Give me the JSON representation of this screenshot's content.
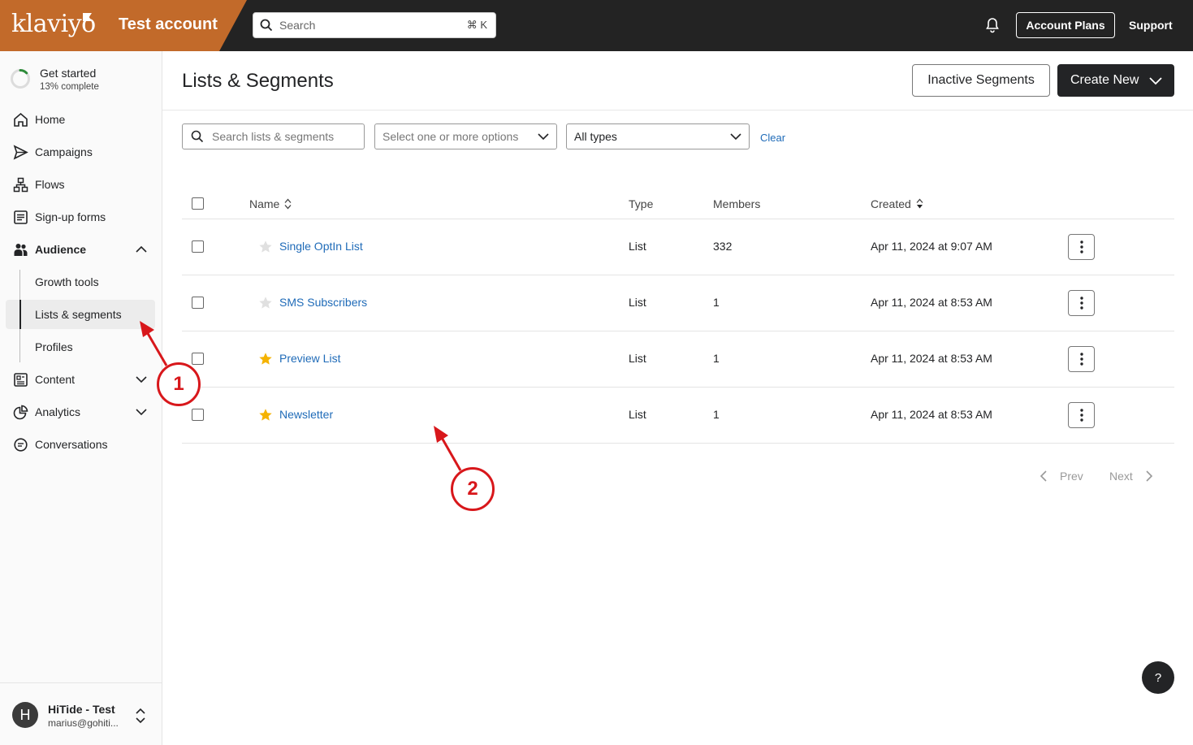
{
  "topbar": {
    "logo": "klaviyo",
    "account_name": "Test account",
    "search_placeholder": "Search",
    "search_shortcut": "⌘ K",
    "account_plans": "Account Plans",
    "support": "Support"
  },
  "sidebar": {
    "get_started": {
      "title": "Get started",
      "progress_text": "13% complete",
      "progress": 0.13
    },
    "items": [
      {
        "label": "Home"
      },
      {
        "label": "Campaigns"
      },
      {
        "label": "Flows"
      },
      {
        "label": "Sign-up forms"
      },
      {
        "label": "Audience"
      },
      {
        "label": "Growth tools"
      },
      {
        "label": "Lists & segments"
      },
      {
        "label": "Profiles"
      },
      {
        "label": "Content"
      },
      {
        "label": "Analytics"
      },
      {
        "label": "Conversations"
      }
    ],
    "user": {
      "initial": "H",
      "name": "HiTide - Test",
      "email": "marius@gohiti..."
    }
  },
  "header": {
    "title": "Lists & Segments",
    "inactive_button": "Inactive Segments",
    "create_button": "Create New"
  },
  "filters": {
    "search_placeholder": "Search lists & segments",
    "tags_placeholder": "Select one or more options",
    "type_value": "All types",
    "clear": "Clear"
  },
  "table": {
    "columns": {
      "name": "Name",
      "type": "Type",
      "members": "Members",
      "created": "Created"
    },
    "rows": [
      {
        "name": "Single OptIn List",
        "type": "List",
        "members": "332",
        "created": "Apr 11, 2024 at 9:07 AM",
        "starred": false
      },
      {
        "name": "SMS Subscribers",
        "type": "List",
        "members": "1",
        "created": "Apr 11, 2024 at 8:53 AM",
        "starred": false
      },
      {
        "name": "Preview List",
        "type": "List",
        "members": "1",
        "created": "Apr 11, 2024 at 8:53 AM",
        "starred": true
      },
      {
        "name": "Newsletter",
        "type": "List",
        "members": "1",
        "created": "Apr 11, 2024 at 8:53 AM",
        "starred": true
      }
    ]
  },
  "pagination": {
    "prev": "Prev",
    "next": "Next"
  },
  "help": "?",
  "annotations": [
    "1",
    "2"
  ],
  "colors": {
    "brand": "#c26a2a",
    "link": "#1f6bb8",
    "star_on": "#f5b301",
    "star_off": "#e0e0e0",
    "annotation": "#d8171b"
  }
}
